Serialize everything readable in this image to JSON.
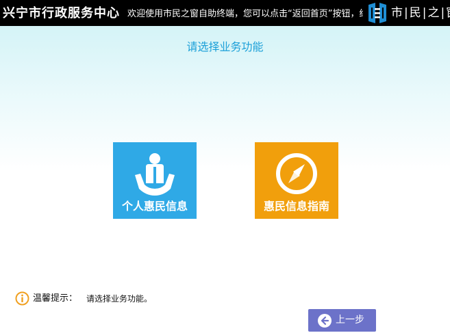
{
  "header": {
    "center_name": "兴宁市行政服务中心",
    "marquee": "欢迎使用市民之窗自助终端，您可以点击“返回首页”按钮，结",
    "brand_text": "市|民|之|窗",
    "brand_icon": "citizen-window-logo-icon"
  },
  "main": {
    "heading": "请选择业务功能",
    "tiles": [
      {
        "label": "个人惠民信息",
        "icon": "person-in-hands-icon",
        "color": "#2fa9e6"
      },
      {
        "label": "惠民信息指南",
        "icon": "compass-icon",
        "color": "#f19f0c"
      }
    ]
  },
  "footer": {
    "tip_label": "温馨提示：",
    "tip_message": "请选择业务功能。",
    "tip_icon": "info-icon",
    "back_button": {
      "label": "上一步",
      "icon": "arrow-left-icon",
      "color": "#6c72c9"
    }
  },
  "colors": {
    "topbar": "#000000",
    "heading": "#1a9fd8",
    "tip_icon": "#f0a020"
  }
}
